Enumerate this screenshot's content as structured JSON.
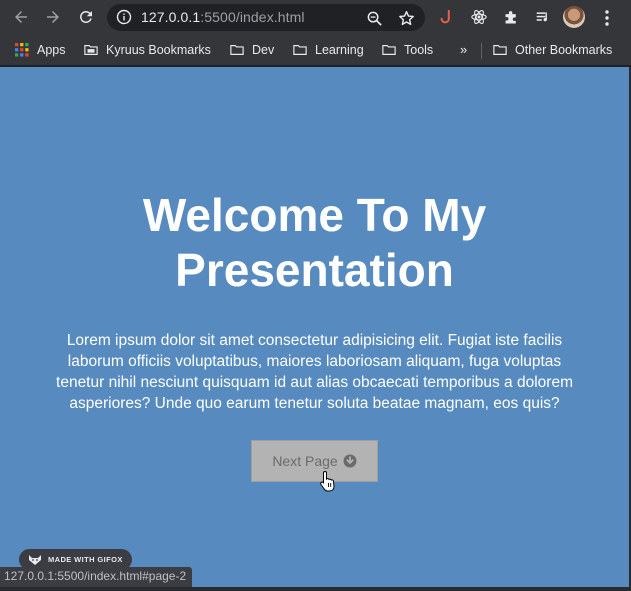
{
  "browser": {
    "url_host": "127.0.0.1",
    "url_rest": ":5500/index.html"
  },
  "bookmarks": {
    "items": [
      {
        "label": "Apps"
      },
      {
        "label": "Kyruus Bookmarks"
      },
      {
        "label": "Dev"
      },
      {
        "label": "Learning"
      },
      {
        "label": "Tools"
      }
    ],
    "overflow": "»",
    "other": "Other Bookmarks"
  },
  "page": {
    "title_line1": "Welcome To My",
    "title_line2": "Presentation",
    "description": "Lorem ipsum dolor sit amet consectetur adipisicing elit. Fugiat iste facilis laborum officiis voluptatibus, maiores laboriosam aliquam, fuga voluptas tenetur nihil nesciunt quisquam id aut alias obcaecati temporibus a dolorem asperiores? Unde quo earum tenetur soluta beatae magnam, eos quis?",
    "next_button": "Next Page"
  },
  "overlay": {
    "gifox_label": "MADE WITH GIFOX",
    "status_url": "127.0.0.1:5500/index.html#page-2"
  },
  "colors": {
    "page_background": "#578bbf",
    "button_background": "#b3b3b3",
    "toolbar": "#35363a"
  }
}
